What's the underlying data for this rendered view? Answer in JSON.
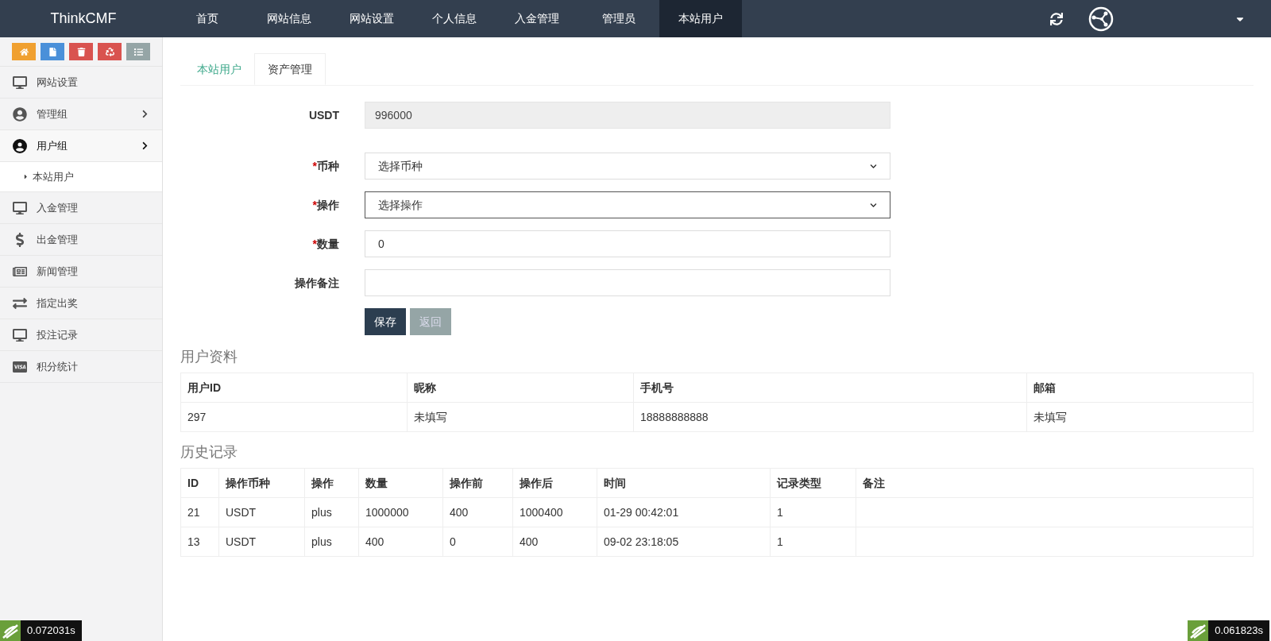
{
  "brand": "ThinkCMF",
  "nav": [
    {
      "label": "首页",
      "selected": false
    },
    {
      "label": "网站信息",
      "selected": false
    },
    {
      "label": "网站设置",
      "selected": false
    },
    {
      "label": "个人信息",
      "selected": false
    },
    {
      "label": "入金管理",
      "selected": false
    },
    {
      "label": "管理员",
      "selected": false
    },
    {
      "label": "本站用户",
      "selected": true
    }
  ],
  "sidebar": {
    "quick_buttons": [
      {
        "kind": "home",
        "color": "#f0a030"
      },
      {
        "kind": "file",
        "color": "#4a90d9"
      },
      {
        "kind": "trash",
        "color": "#d9534f"
      },
      {
        "kind": "recycle",
        "color": "#d9534f"
      },
      {
        "kind": "list",
        "color": "#95a5a6"
      }
    ],
    "items": [
      {
        "label": "网站设置",
        "kind": "monitor",
        "expanded": false,
        "has_arrow": false
      },
      {
        "label": "管理组",
        "kind": "usercircle",
        "expanded": false,
        "has_arrow": true
      },
      {
        "label": "用户组",
        "kind": "user",
        "expanded": true,
        "has_arrow": true,
        "children": [
          {
            "label": "本站用户"
          }
        ]
      },
      {
        "label": "入金管理",
        "kind": "monitor",
        "expanded": false,
        "has_arrow": false
      },
      {
        "label": "出金管理",
        "kind": "dollar",
        "expanded": false,
        "has_arrow": false
      },
      {
        "label": "新闻管理",
        "kind": "news",
        "expanded": false,
        "has_arrow": false
      },
      {
        "label": "指定出奖",
        "kind": "exchange",
        "expanded": false,
        "has_arrow": false
      },
      {
        "label": "投注记录",
        "kind": "monitor",
        "expanded": false,
        "has_arrow": false
      },
      {
        "label": "积分统计",
        "kind": "visa",
        "expanded": false,
        "has_arrow": false
      }
    ]
  },
  "tabs": [
    {
      "label": "本站用户",
      "selected": false
    },
    {
      "label": "资产管理",
      "selected": true
    }
  ],
  "form": [
    {
      "kind": "readonly",
      "label": "USDT",
      "value": "996000"
    },
    {
      "kind": "select",
      "label": "币种",
      "mark": "*",
      "value": "选择币种",
      "focused": false
    },
    {
      "kind": "select",
      "label": "操作",
      "mark": "*",
      "value": "选择操作",
      "focused": true
    },
    {
      "kind": "input",
      "label": "数量",
      "mark": "*",
      "value": "0"
    },
    {
      "kind": "input",
      "label": "操作备注"
    }
  ],
  "buttons": [
    {
      "label": "保存",
      "kind": "primary"
    },
    {
      "label": "返回",
      "kind": "secondary"
    }
  ],
  "user_info": {
    "title": "用户资料",
    "columns": [
      "用户ID",
      "昵称",
      "手机号",
      "邮箱"
    ],
    "rows": [
      [
        "297",
        "未填写",
        "18888888888",
        "未填写"
      ]
    ]
  },
  "history": {
    "title": "历史记录",
    "columns": [
      "ID",
      "操作币种",
      "操作",
      "数量",
      "操作前",
      "操作后",
      "时间",
      "记录类型",
      "备注"
    ],
    "rows": [
      [
        "21",
        "USDT",
        "plus",
        "1000000",
        "400",
        "1000400",
        "01-29 00:42:01",
        "1",
        ""
      ],
      [
        "13",
        "USDT",
        "plus",
        "400",
        "0",
        "400",
        "09-02 23:18:05",
        "1",
        ""
      ]
    ]
  },
  "timings": [
    "0.072031s",
    "0.061823s"
  ]
}
